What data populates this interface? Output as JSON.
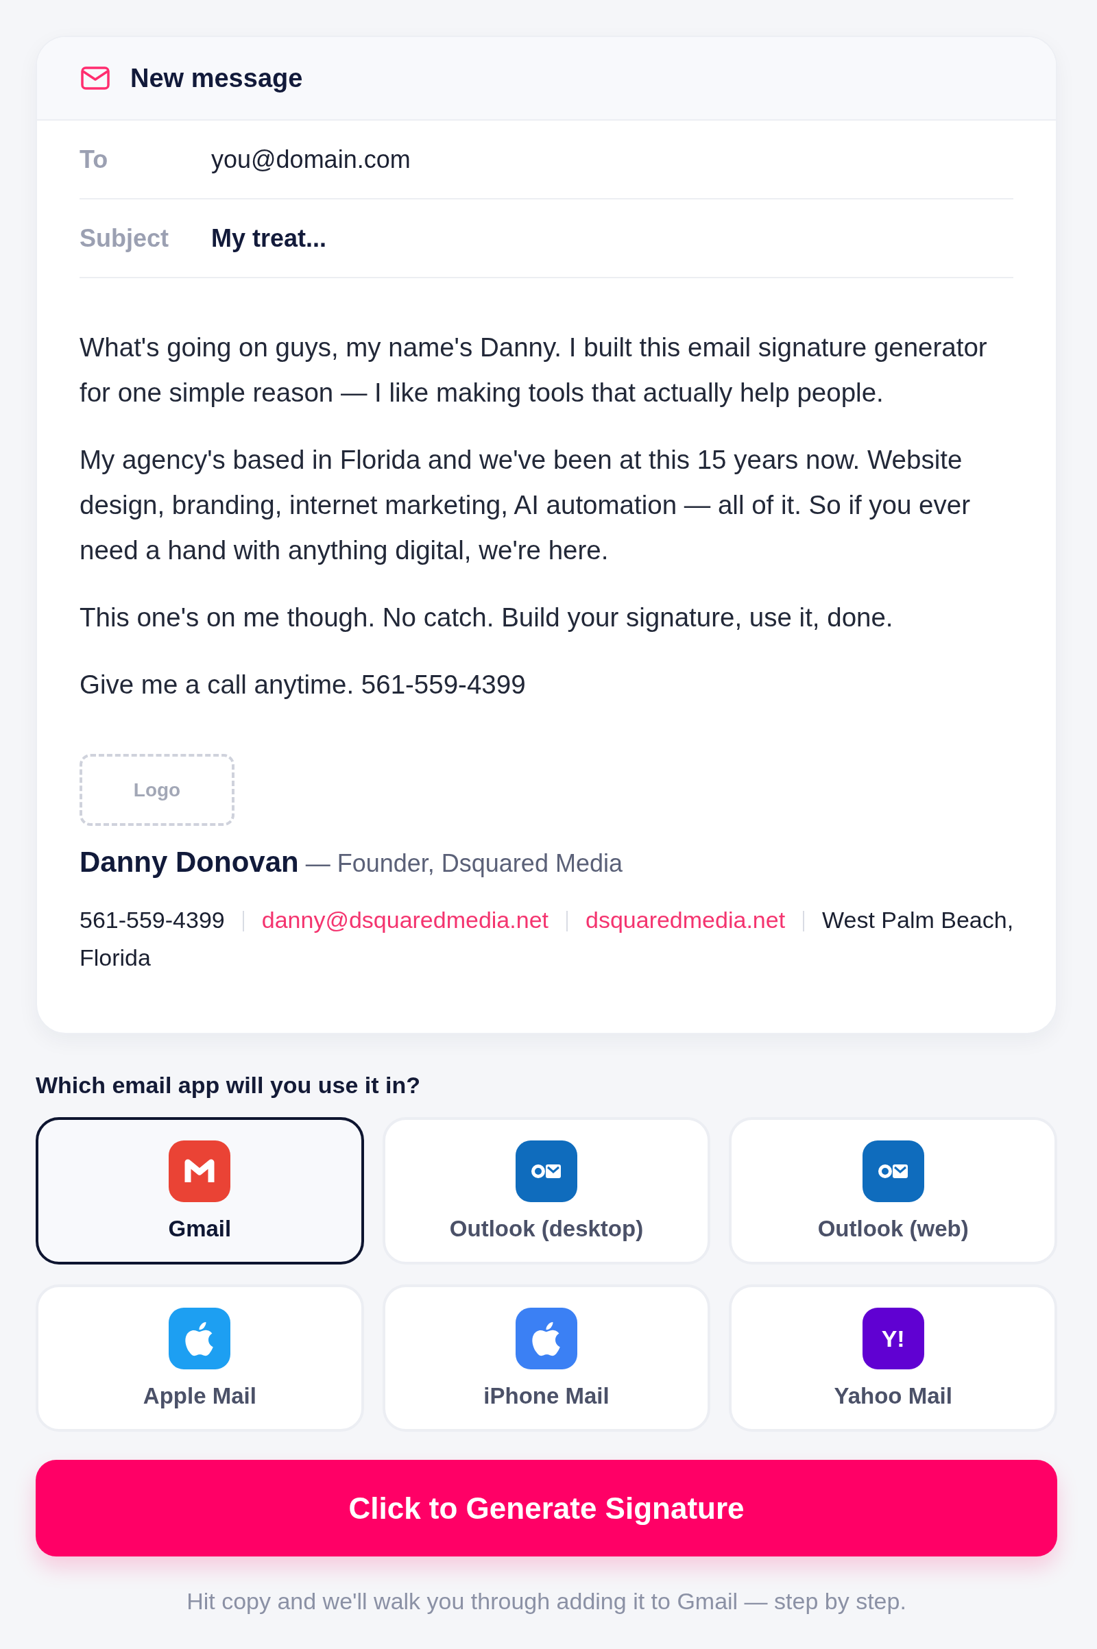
{
  "compose": {
    "title": "New message",
    "fields": [
      {
        "kind": "address",
        "label": "To",
        "value": "you@domain.com"
      },
      {
        "kind": "subject",
        "label": "Subject",
        "value": "My treat..."
      }
    ],
    "body": [
      "What's going on guys, my name's Danny. I built this email signature generator for one simple reason — I like making tools that actually help people.",
      "My agency's based in Florida and we've been at this 15 years now. Website design, branding, internet marketing, AI automation — all of it. So if you ever need a hand with anything digital, we're here.",
      "This one's on me though. No catch. Build your signature, use it, done.",
      "Give me a call anytime. 561-559-4399"
    ],
    "signature": {
      "logo_placeholder": "Logo",
      "name": "Danny Donovan",
      "title": "— Founder, Dsquared Media",
      "contacts": [
        {
          "kind": "phone",
          "text": "561-559-4399"
        },
        {
          "kind": "email",
          "text": "danny@dsquaredmedia.net"
        },
        {
          "kind": "website",
          "text": "dsquaredmedia.net"
        },
        {
          "kind": "location",
          "text": "West Palm Beach, Florida"
        }
      ]
    }
  },
  "app_picker": {
    "question": "Which email app will you use it in?",
    "apps": [
      {
        "label": "Gmail",
        "kind": "m",
        "color": "#ea4335",
        "selected": true
      },
      {
        "label": "Outlook (desktop)",
        "kind": "outlook",
        "color": "#0f6cbd",
        "selected": false
      },
      {
        "label": "Outlook (web)",
        "kind": "outlook",
        "color": "#0f6cbd",
        "selected": false
      },
      {
        "label": "Apple Mail",
        "kind": "apple",
        "color": "#1d9ff2",
        "selected": false
      },
      {
        "label": "iPhone Mail",
        "kind": "apple",
        "color": "#3b80f4",
        "selected": false
      },
      {
        "label": "Yahoo Mail",
        "kind": "text",
        "icon_text": "Y!",
        "color": "#6001d2",
        "selected": false
      }
    ]
  },
  "generate_button": "Click to Generate Signature",
  "helper_text": "Hit copy and we'll walk you through adding it to Gmail — step by step."
}
